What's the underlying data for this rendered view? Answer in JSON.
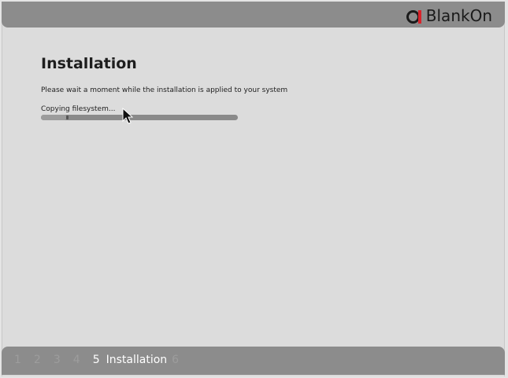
{
  "brand": {
    "logo_text": "BlankOn",
    "colors": {
      "ring": "#1a1a1a",
      "bar": "#d9232a"
    }
  },
  "page": {
    "title": "Installation",
    "description": "Please wait a moment while the installation is applied to your system",
    "status": "Copying filesystem..."
  },
  "progress": {
    "value": 0.13
  },
  "steps": {
    "items": [
      "1",
      "2",
      "3",
      "4",
      "5",
      "6"
    ],
    "active_index": 4,
    "active_label": "Installation"
  }
}
